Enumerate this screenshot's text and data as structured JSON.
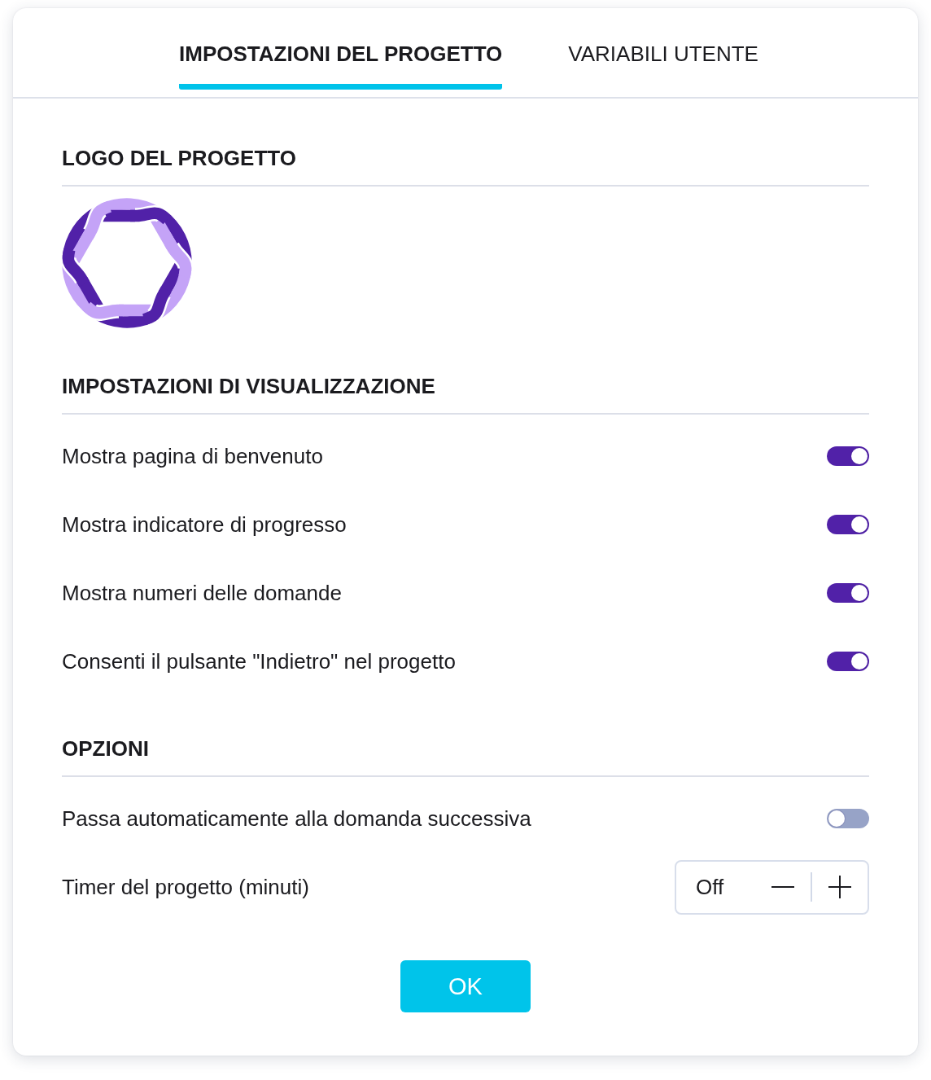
{
  "tabs": [
    {
      "label": "IMPOSTAZIONI DEL PROGETTO",
      "selected": true
    },
    {
      "label": "VARIABILI UTENTE",
      "selected": false
    }
  ],
  "sections": [
    {
      "kind": "logo",
      "title": "LOGO DEL PROGETTO"
    },
    {
      "kind": "settings",
      "title": "IMPOSTAZIONI DI VISUALIZZAZIONE",
      "rows": [
        {
          "kind": "toggle",
          "label": "Mostra pagina di benvenuto",
          "on": true
        },
        {
          "kind": "toggle",
          "label": "Mostra indicatore di progresso",
          "on": true
        },
        {
          "kind": "toggle",
          "label": "Mostra numeri delle domande",
          "on": true
        },
        {
          "kind": "toggle",
          "label": "Consenti il pulsante \"Indietro\" nel progetto",
          "on": true
        }
      ]
    },
    {
      "kind": "settings",
      "title": "OPZIONI",
      "rows": [
        {
          "kind": "toggle",
          "label": "Passa automaticamente alla domanda successiva",
          "on": false
        },
        {
          "kind": "stepper",
          "label": "Timer del progetto (minuti)",
          "value": "Off"
        }
      ]
    }
  ],
  "ok_button": "OK"
}
